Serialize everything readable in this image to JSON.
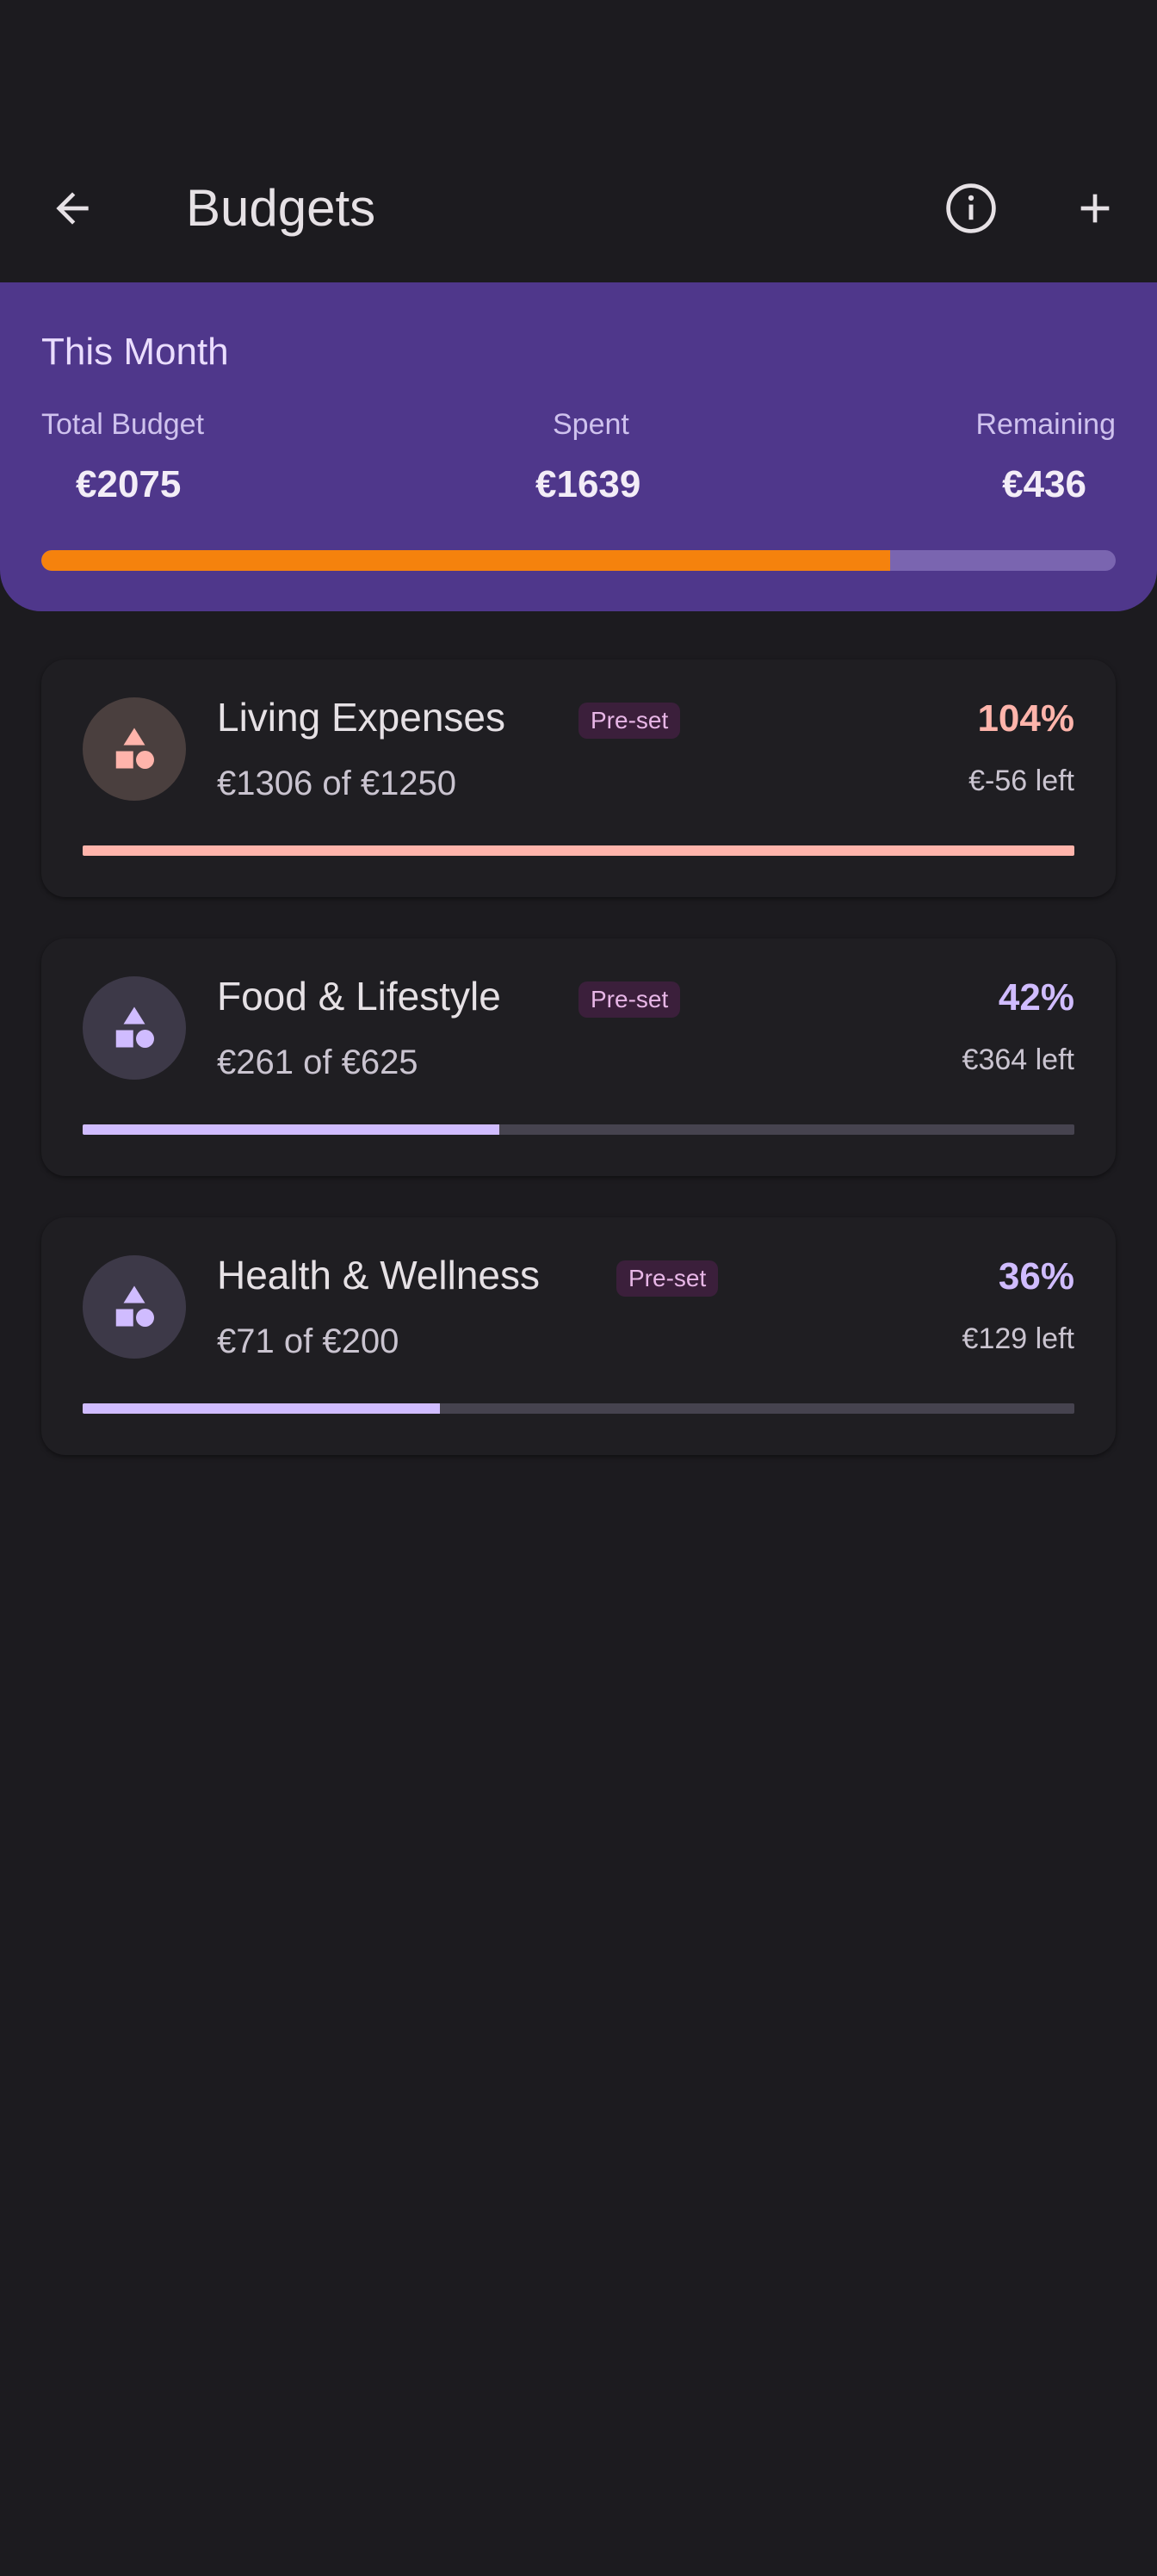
{
  "header": {
    "title": "Budgets",
    "back_icon": "arrow-back-icon",
    "info_icon": "info-icon",
    "add_icon": "plus-icon"
  },
  "summary": {
    "title": "This Month",
    "total_label": "Total Budget",
    "total_value": "€2075",
    "spent_label": "Spent",
    "spent_value": "€1639",
    "remaining_label": "Remaining",
    "remaining_value": "€436",
    "progress_fraction": 0.79,
    "bar_color": "#f5820d",
    "card_color": "#4f378b"
  },
  "budgets": [
    {
      "name": "Living Expenses",
      "badge": "Pre-set",
      "amount": "€1306 of €1250",
      "percent": "104%",
      "left": "€-56 left",
      "progress_fraction": 1.0,
      "accent_color": "#ffb4ab",
      "icon_bg": "#4a3f3e",
      "icon": "category-shapes-icon"
    },
    {
      "name": "Food & Lifestyle",
      "badge": "Pre-set",
      "amount": "€261 of €625",
      "percent": "42%",
      "left": "€364 left",
      "progress_fraction": 0.42,
      "accent_color": "#d0bcff",
      "icon_bg": "#3d3948",
      "icon": "category-shapes-icon"
    },
    {
      "name": "Health & Wellness",
      "badge": "Pre-set",
      "amount": "€71 of €200",
      "percent": "36%",
      "left": "€129 left",
      "progress_fraction": 0.36,
      "accent_color": "#d0bcff",
      "icon_bg": "#3d3948",
      "icon": "category-shapes-icon"
    }
  ]
}
